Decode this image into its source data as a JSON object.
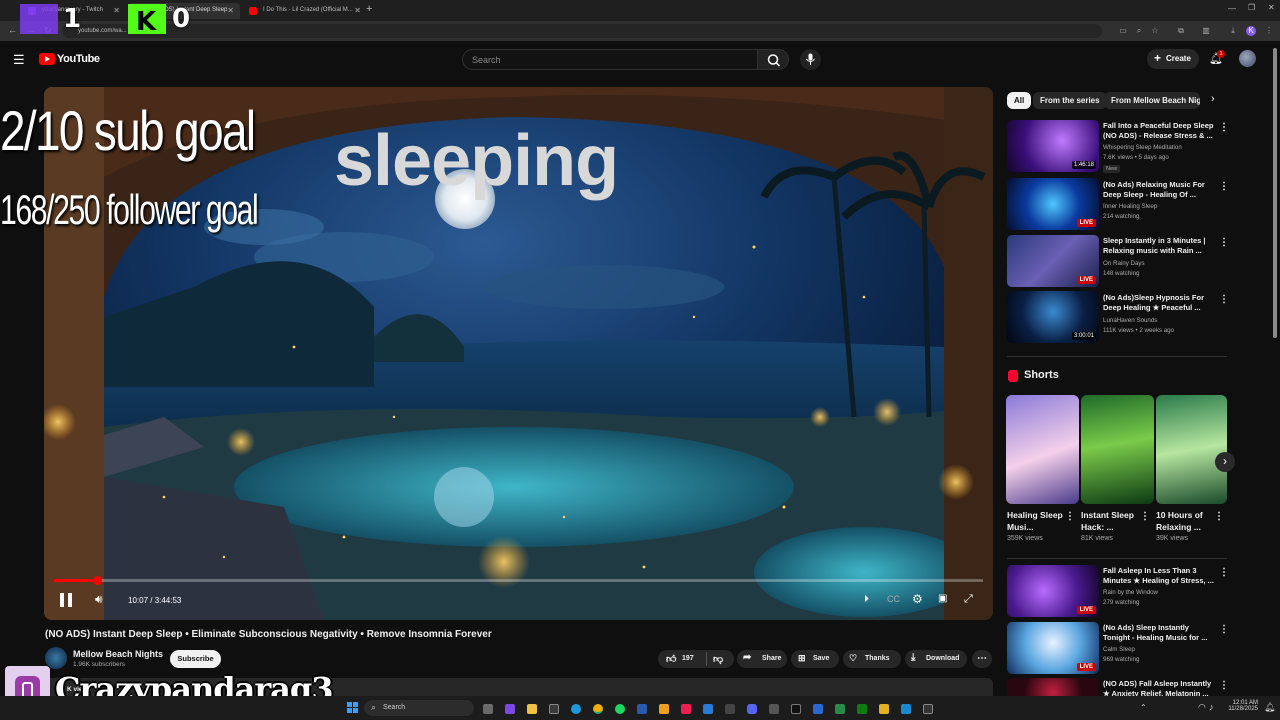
{
  "browser": {
    "tabs": [
      {
        "label": "yourSanctuary - Twitch",
        "active": false
      },
      {
        "label": "(NO ADS) Instant Deep Sleep",
        "active": true
      },
      {
        "label": "I Do This - Lil Crazed (Official M...",
        "active": false
      }
    ],
    "url": "youtube.com/wa..."
  },
  "overlay": {
    "counter_left": "1",
    "counter_right": "0",
    "sub_goal": "2/10 sub goal",
    "follower_goal": "168/250 follower goal",
    "status": "sleeping",
    "streamer_name": "Crazypandarag3"
  },
  "header": {
    "logo": "YouTube",
    "search_placeholder": "Search",
    "create_label": "Create",
    "notification_count": "1"
  },
  "player": {
    "progress": 0.046,
    "time": "10:07 / 3:44:53"
  },
  "video": {
    "title": "(NO ADS) Instant Deep Sleep • Eliminate Subconscious Negativity • Remove Insomnia Forever",
    "channel": "Mellow Beach Nights",
    "subscribers": "1.96K subscribers",
    "subscribe_label": "Subscribe",
    "likes": "197",
    "share_label": "Share",
    "save_label": "Save",
    "thanks_label": "Thanks",
    "download_label": "Download",
    "desc_preview": "K views"
  },
  "sidebar": {
    "chips": [
      "All",
      "From the series",
      "From Mellow Beach Nigh"
    ],
    "recs": [
      {
        "title": "Fall Into a Peaceful Deep Sleep (NO ADS) - Release Stress & ...",
        "channel": "Whispering Sleep Meditation",
        "meta": "7.6K views • 5 days ago",
        "badge": "New",
        "duration": "1:46:18",
        "live": false
      },
      {
        "title": "(No Ads) Relaxing Music For Deep Sleep - Healing Of ...",
        "channel": "Inner Healing Sleep",
        "meta": "214 watching",
        "badge": "",
        "duration": "LIVE",
        "live": true
      },
      {
        "title": "Sleep Instantly in 3 Minutes | Relaxing music with Rain ...",
        "channel": "On Rainy Days",
        "meta": "148 watching",
        "badge": "",
        "duration": "LIVE",
        "live": true
      },
      {
        "title": "(No Ads)Sleep Hypnosis For Deep Healing ★ Peaceful ...",
        "channel": "LunaHaven Sounds",
        "meta": "111K views • 2 weeks ago",
        "badge": "",
        "duration": "3:00:01",
        "live": false
      }
    ],
    "shorts_heading": "Shorts",
    "shorts": [
      {
        "title": "Healing Sleep Musi...",
        "views": "359K views"
      },
      {
        "title": "Instant Sleep Hack: ...",
        "views": "81K views"
      },
      {
        "title": "10 Hours of Relaxing ...",
        "views": "39K views"
      }
    ],
    "recs2": [
      {
        "title": "Fall Asleep In Less Than 3 Minutes ★ Healing of Stress, ...",
        "channel": "Rain by the Window",
        "meta": "279 watching",
        "duration": "LIVE"
      },
      {
        "title": "(No Ads) Sleep Instantly Tonight - Healing Music for ...",
        "channel": "Calm Sleep",
        "meta": "969 watching",
        "duration": "LIVE"
      },
      {
        "title": "(NO ADS) Fall Asleep Instantly ★ Anxiety Relief, Melatonin ...",
        "channel": "",
        "meta": "",
        "duration": ""
      }
    ]
  },
  "taskbar": {
    "search_label": "Search",
    "time": "12:01 AM",
    "date": "11/28/2025"
  }
}
